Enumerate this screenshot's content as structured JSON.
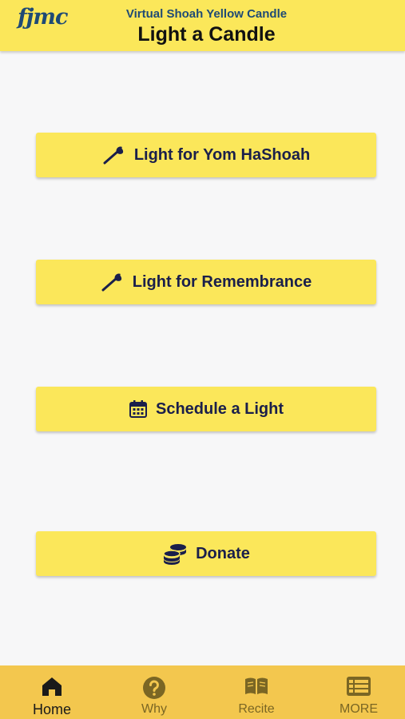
{
  "header": {
    "logo": "fjmc",
    "subtitle": "Virtual Shoah Yellow Candle",
    "title": "Light a Candle"
  },
  "actions": [
    {
      "label": "Light for Yom HaShoah",
      "icon": "match-icon"
    },
    {
      "label": "Light for Remembrance",
      "icon": "match-icon"
    },
    {
      "label": "Schedule a Light",
      "icon": "calendar-icon"
    },
    {
      "label": "Donate",
      "icon": "coins-icon"
    }
  ],
  "tabs": [
    {
      "label": "Home",
      "icon": "home-icon",
      "active": true
    },
    {
      "label": "Why",
      "icon": "question-icon",
      "active": false
    },
    {
      "label": "Recite",
      "icon": "book-icon",
      "active": false
    },
    {
      "label": "MORE",
      "icon": "list-icon",
      "active": false
    }
  ],
  "colors": {
    "accent": "#fbe75a",
    "tabbar": "#f3c74e",
    "navy": "#1a1f4b",
    "brand_blue": "#1f4a75"
  }
}
